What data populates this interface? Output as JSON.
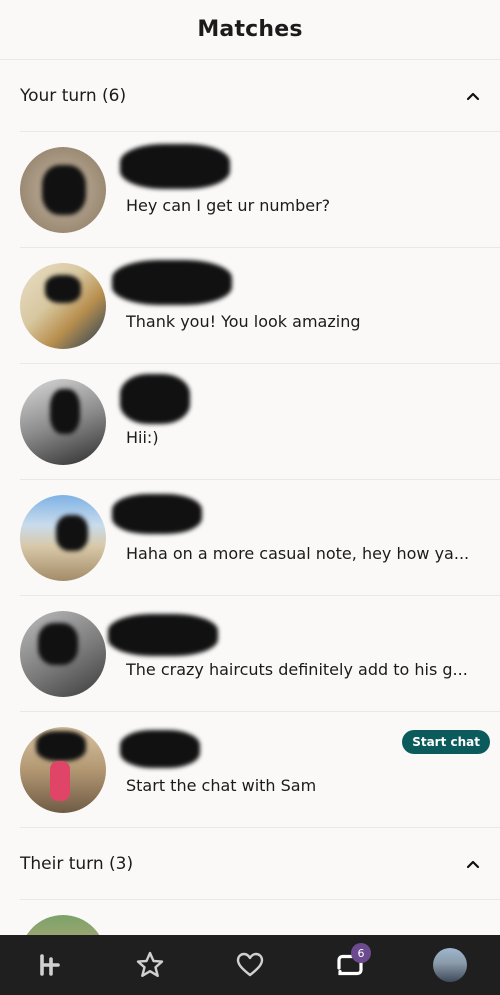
{
  "header": {
    "title": "Matches"
  },
  "sections": {
    "your_turn": {
      "label": "Your turn (6)"
    },
    "their_turn": {
      "label": "Their turn (3)"
    }
  },
  "matches": [
    {
      "message": "Hey can I get ur number?"
    },
    {
      "message": "Thank you! You look amazing"
    },
    {
      "message": "Hii:)"
    },
    {
      "message": "Haha on a more casual note, hey how ya..."
    },
    {
      "message": "The crazy haircuts definitely add to his g..."
    },
    {
      "message": "Start the chat with Sam",
      "badge": "Start chat"
    }
  ],
  "bottom_nav": {
    "items": [
      {
        "icon": "hinge-logo-icon"
      },
      {
        "icon": "star-icon"
      },
      {
        "icon": "heart-icon"
      },
      {
        "icon": "matches-chat-icon",
        "badge": "6"
      },
      {
        "icon": "profile-avatar"
      }
    ]
  },
  "colors": {
    "background": "#faf9f8",
    "nav_background": "#1f1f1f",
    "start_chat": "#0b5a5c",
    "badge": "#6c4a8f"
  }
}
